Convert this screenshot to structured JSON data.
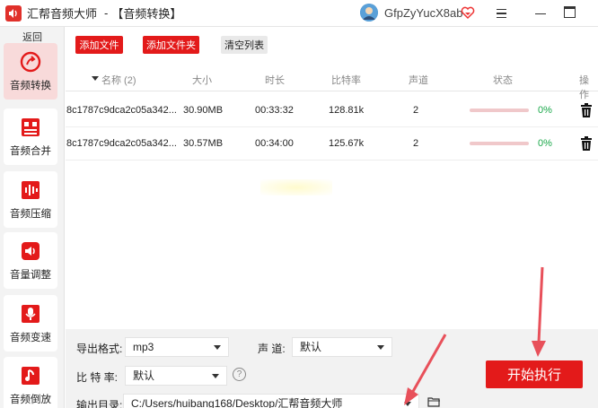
{
  "window": {
    "app_title": "汇帮音频大师",
    "separator": "-",
    "page_title": "【音频转换】",
    "username": "GfpZyYucX8ab"
  },
  "sidebar": {
    "back_label": "返回",
    "items": [
      {
        "label": "音频转换",
        "icon": "convert-icon",
        "active": true
      },
      {
        "label": "音频合并",
        "icon": "merge-icon",
        "active": false
      },
      {
        "label": "音频压缩",
        "icon": "compress-icon",
        "active": false
      },
      {
        "label": "音量调整",
        "icon": "volume-icon",
        "active": false
      },
      {
        "label": "音频变速",
        "icon": "microphone-icon",
        "active": false
      },
      {
        "label": "音频倒放",
        "icon": "music-note-icon",
        "active": false
      }
    ]
  },
  "toolbar": {
    "add_file": "添加文件",
    "add_folder": "添加文件夹",
    "clear_list": "清空列表"
  },
  "table": {
    "headers": {
      "name": "名称 (2)",
      "size": "大小",
      "duration": "时长",
      "bitrate": "比特率",
      "channel": "声道",
      "status": "状态",
      "action": "操作"
    },
    "rows": [
      {
        "name": "8c1787c9dca2c05a342...",
        "size": "30.90MB",
        "duration": "00:33:32",
        "bitrate": "128.81k",
        "channel": "2",
        "progress": "0%"
      },
      {
        "name": "8c1787c9dca2c05a342...",
        "size": "30.57MB",
        "duration": "00:34:00",
        "bitrate": "125.67k",
        "channel": "2",
        "progress": "0%"
      }
    ]
  },
  "settings": {
    "format_label": "导出格式:",
    "format_value": "mp3",
    "channel_label": "声  道:",
    "channel_value": "默认",
    "bitrate_label": "比 特 率:",
    "bitrate_value": "默认",
    "help_icon": "?",
    "output_label": "输出目录:",
    "output_value": "C:/Users/huibang168/Desktop/汇帮音频大师"
  },
  "start_button": "开始执行",
  "colors": {
    "accent": "#e31a1a",
    "sidebar_active_bg": "#f8dada",
    "progress_green": "#1aa84a"
  }
}
